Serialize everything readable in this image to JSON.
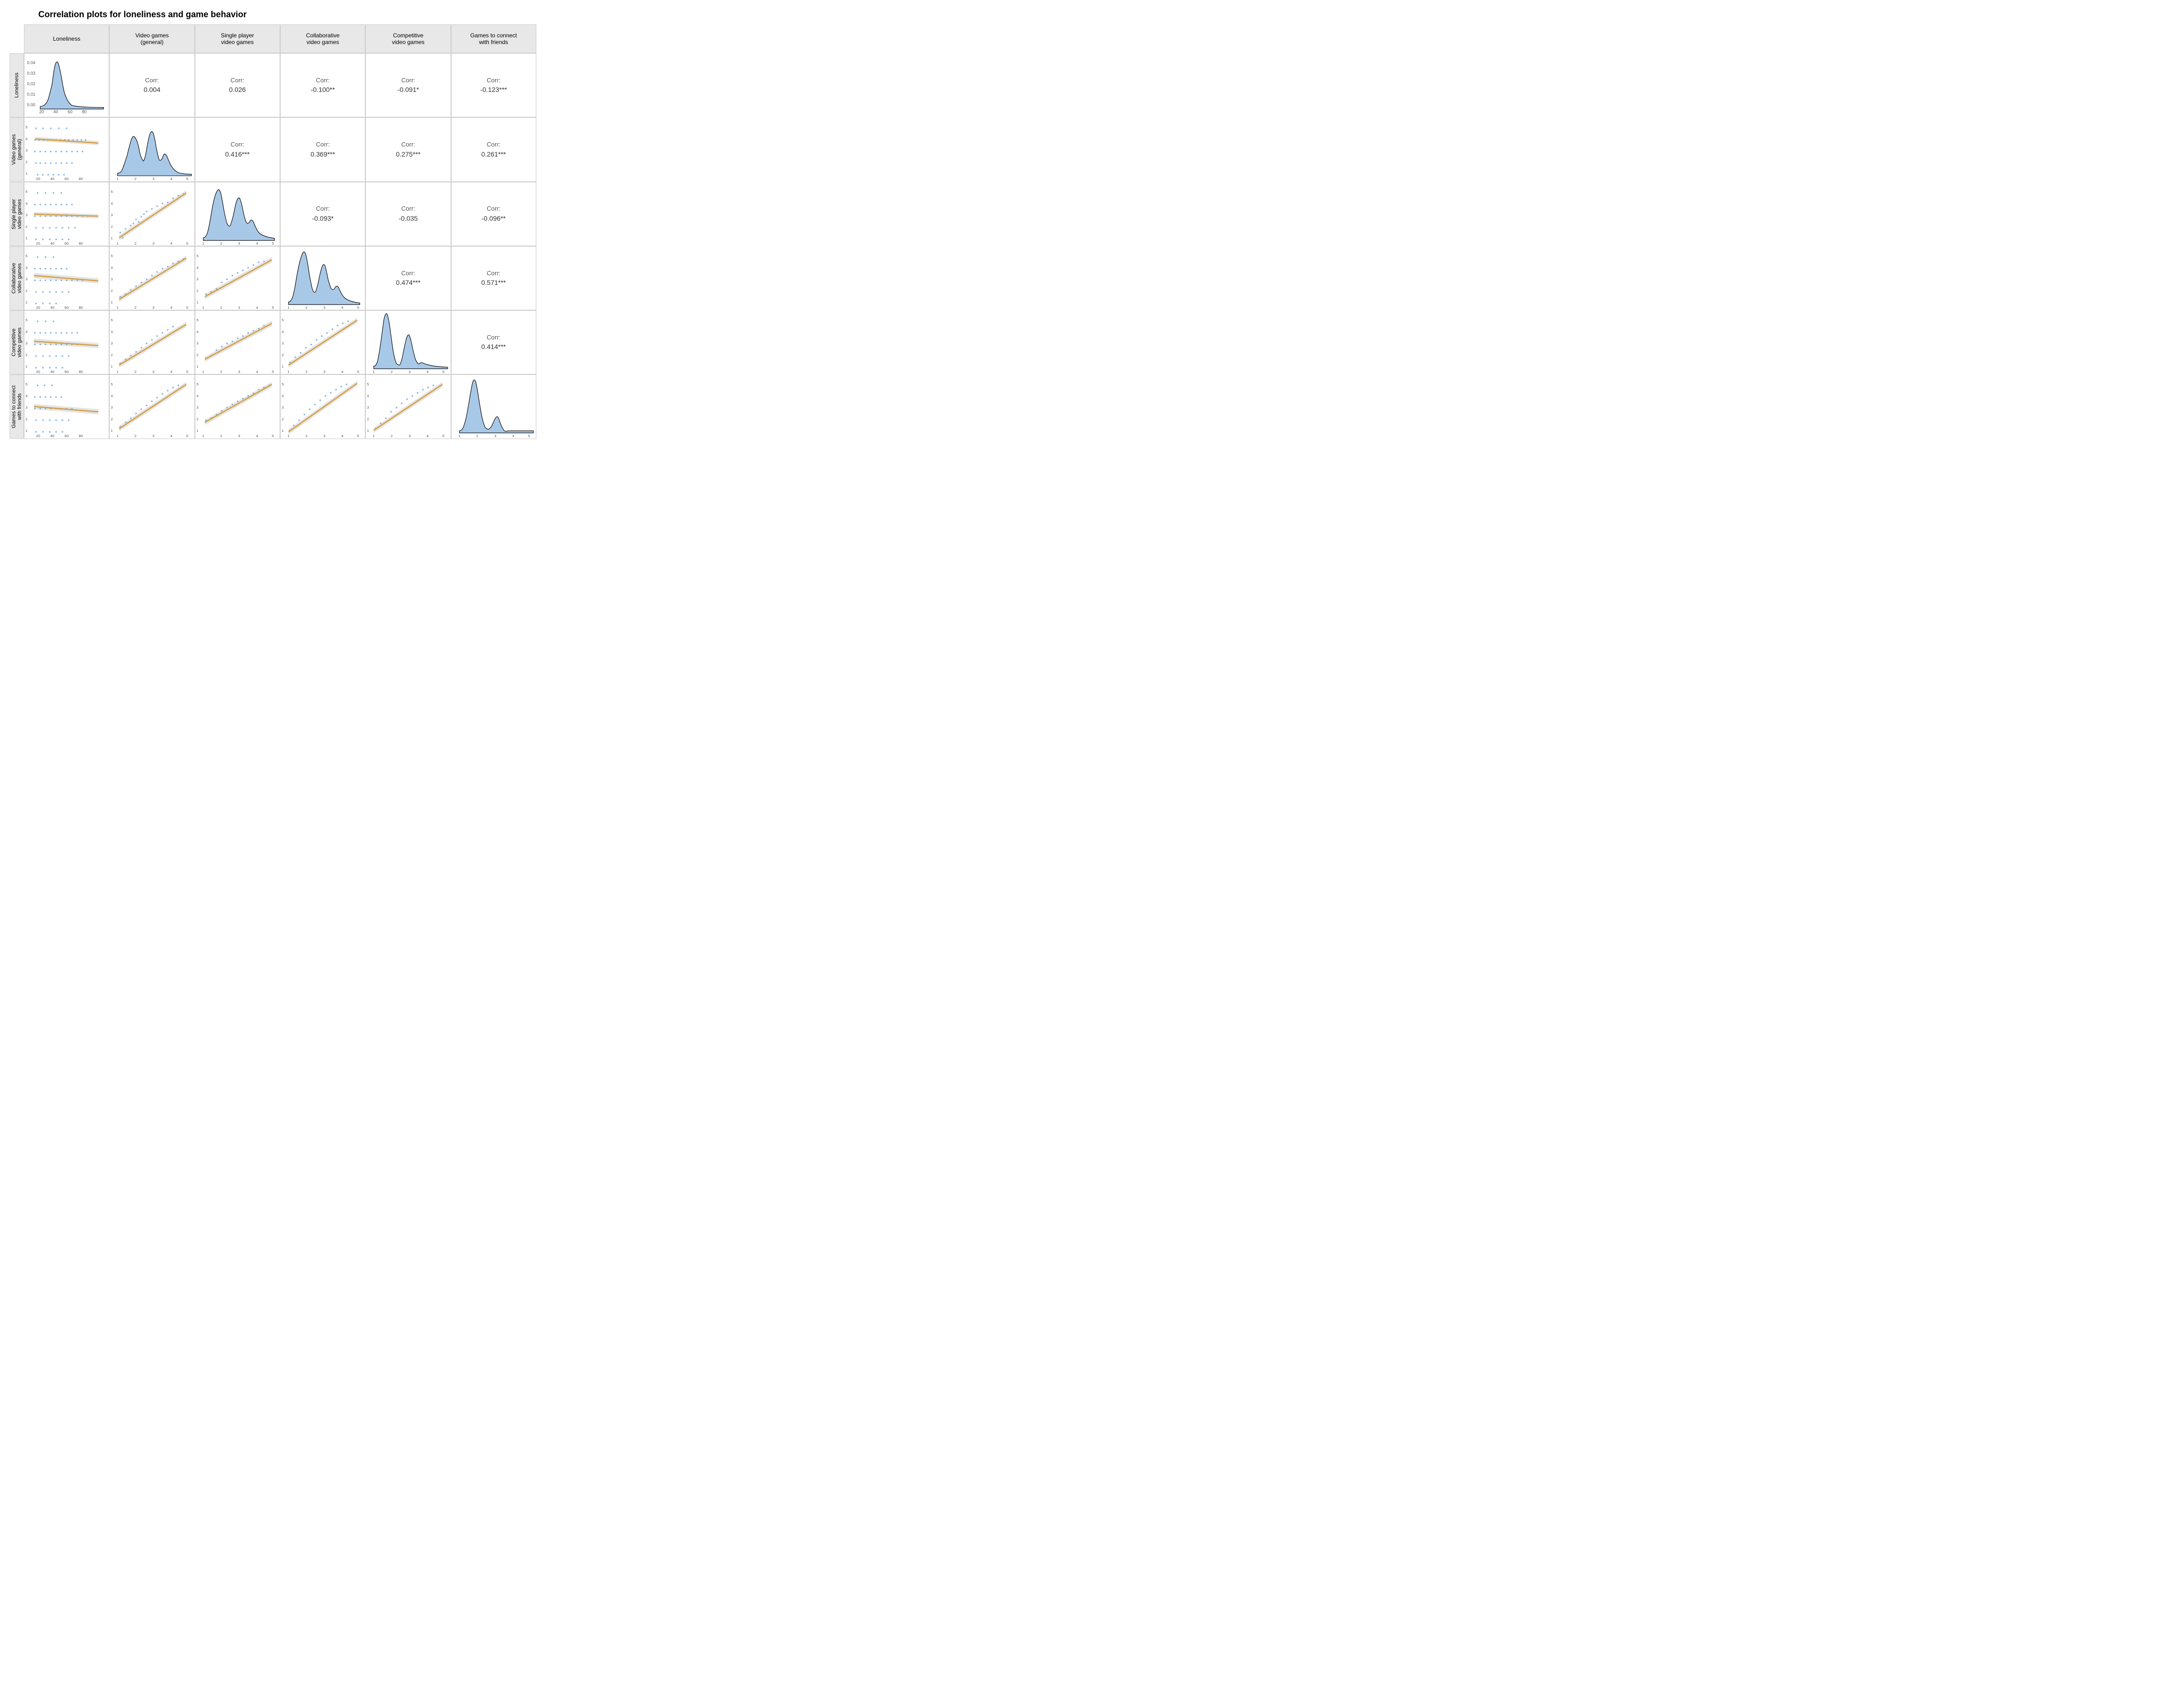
{
  "title": "Correlation plots for loneliness and game behavior",
  "col_headers": [
    "Loneliness",
    "Video games\n(general)",
    "Single player\nvideo games",
    "Collaborative\nvideo games",
    "Competitive\nvideo games",
    "Games to connect\nwith friends"
  ],
  "row_headers": [
    "Loneliness",
    "Video games\n(general)",
    "Single player\nvideo games",
    "Collaborative\nvideo games",
    "Competitive\nvideo games",
    "Games to connect\nwith friends"
  ],
  "correlations": {
    "r1c2": {
      "label": "Corr:",
      "value": "0.004"
    },
    "r1c3": {
      "label": "Corr:",
      "value": "0.026"
    },
    "r1c4": {
      "label": "Corr:",
      "value": "-0.100**"
    },
    "r1c5": {
      "label": "Corr:",
      "value": "-0.091*"
    },
    "r1c6": {
      "label": "Corr:",
      "value": "-0.123***"
    },
    "r2c3": {
      "label": "Corr:",
      "value": "0.416***"
    },
    "r2c4": {
      "label": "Corr:",
      "value": "0.369***"
    },
    "r2c5": {
      "label": "Corr:",
      "value": "0.275***"
    },
    "r2c6": {
      "label": "Corr:",
      "value": "0.261***"
    },
    "r3c4": {
      "label": "Corr:",
      "value": "-0.093*"
    },
    "r3c5": {
      "label": "Corr:",
      "value": "-0.035"
    },
    "r3c6": {
      "label": "Corr:",
      "value": "-0.096**"
    },
    "r4c5": {
      "label": "Corr:",
      "value": "0.474***"
    },
    "r4c6": {
      "label": "Corr:",
      "value": "0.571***"
    },
    "r5c6": {
      "label": "Corr:",
      "value": "0.414***"
    }
  }
}
